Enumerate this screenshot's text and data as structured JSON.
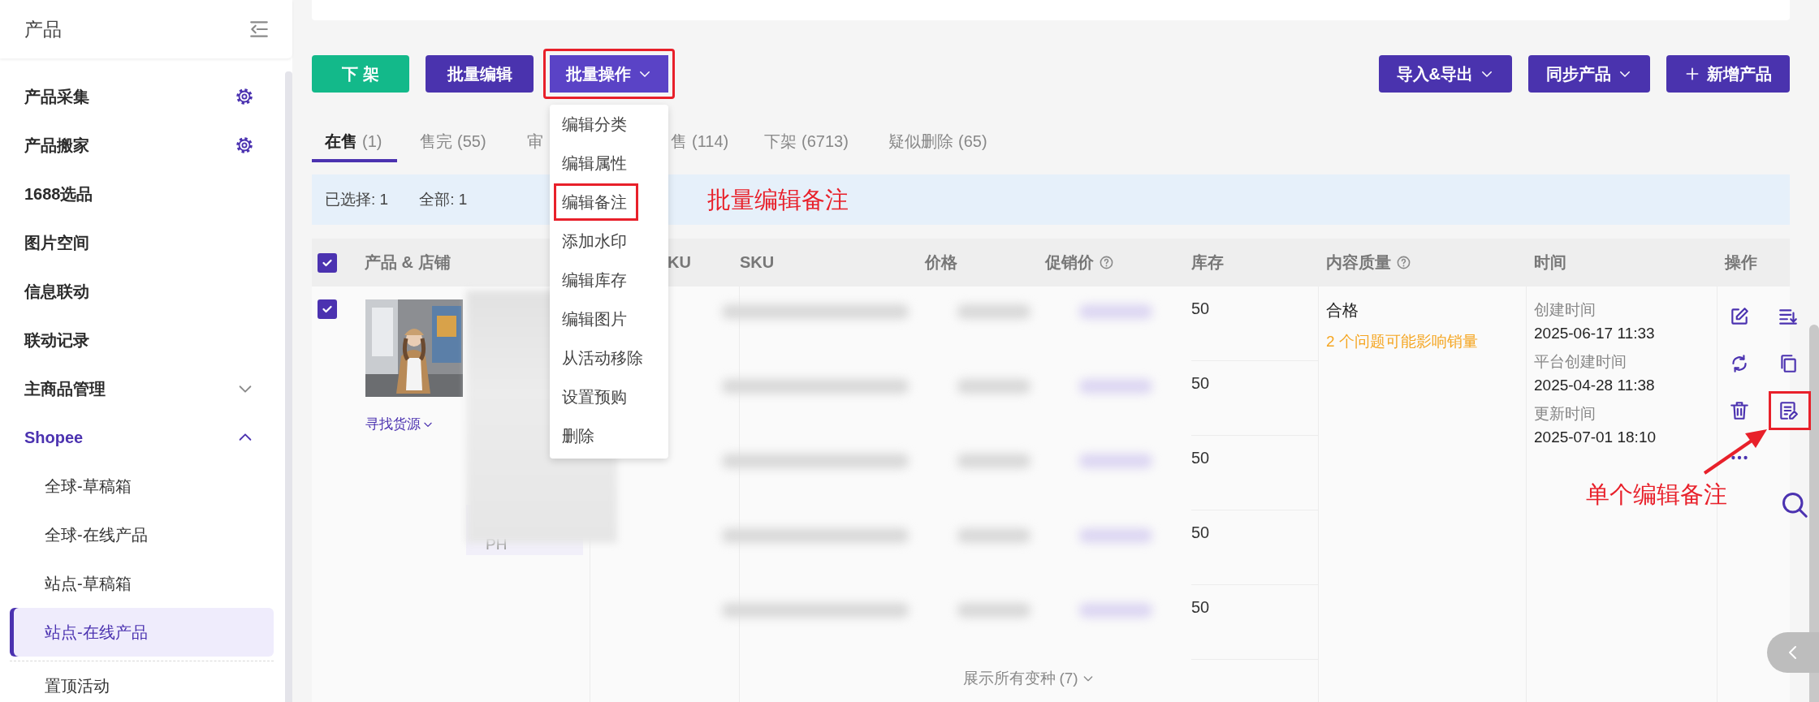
{
  "sidebar": {
    "title": "产品",
    "items": [
      {
        "label": "产品采集",
        "kind": "setting"
      },
      {
        "label": "产品搬家",
        "kind": "setting"
      },
      {
        "label": "1688选品",
        "kind": "plain"
      },
      {
        "label": "图片空间",
        "kind": "plain"
      },
      {
        "label": "信息联动",
        "kind": "plain"
      },
      {
        "label": "联动记录",
        "kind": "plain"
      },
      {
        "label": "主商品管理",
        "kind": "group",
        "expanded": false
      },
      {
        "label": "Shopee",
        "kind": "group",
        "expanded": true,
        "children": [
          {
            "label": "全球-草稿箱",
            "selected": false,
            "divider_before": false
          },
          {
            "label": "全球-在线产品",
            "selected": false,
            "divider_before": false
          },
          {
            "label": "站点-草稿箱",
            "selected": false,
            "divider_before": false
          },
          {
            "label": "站点-在线产品",
            "selected": true,
            "divider_before": false
          },
          {
            "label": "置顶活动",
            "selected": false,
            "divider_before": true
          }
        ]
      }
    ]
  },
  "toolbar": {
    "left_buttons": [
      {
        "label": "下 架",
        "kind": "success",
        "caret": false,
        "annotated": false
      },
      {
        "label": "批量编辑",
        "kind": "primary",
        "caret": false,
        "annotated": false
      },
      {
        "label": "批量操作",
        "kind": "accent",
        "caret": true,
        "annotated": true
      }
    ],
    "right_buttons": [
      {
        "label": "导入&导出",
        "kind": "primary",
        "caret": true
      },
      {
        "label": "同步产品",
        "kind": "primary",
        "caret": true
      },
      {
        "label": "新增产品",
        "kind": "add",
        "caret": false
      }
    ]
  },
  "dropdown_menu": [
    {
      "label": "编辑分类",
      "annotated": false
    },
    {
      "label": "编辑属性",
      "annotated": false
    },
    {
      "label": "编辑备注",
      "annotated": true
    },
    {
      "label": "添加水印",
      "annotated": false
    },
    {
      "label": "编辑库存",
      "annotated": false
    },
    {
      "label": "编辑图片",
      "annotated": false
    },
    {
      "label": "从活动移除",
      "annotated": false
    },
    {
      "label": "设置预购",
      "annotated": false
    },
    {
      "label": "删除",
      "annotated": false
    }
  ],
  "tabs": [
    {
      "label": "在售",
      "count": "(1)",
      "selected": true
    },
    {
      "label": "售完",
      "count": "(55)",
      "selected": false
    },
    {
      "label": "审",
      "selected": false
    },
    {
      "label": "售",
      "count": "(114)",
      "selected": false
    },
    {
      "label": "下架",
      "count": "(6713)",
      "selected": false
    },
    {
      "label": "疑似删除",
      "count": "(65)",
      "selected": false
    }
  ],
  "selection_bar": {
    "selected": "已选择: 1",
    "total": "全部: 1"
  },
  "table": {
    "all_checked": true,
    "columns": [
      {
        "label": "产品 & 店铺",
        "help": false
      },
      {
        "label": "KU",
        "help": false
      },
      {
        "label": "SKU",
        "help": false
      },
      {
        "label": "价格",
        "help": false
      },
      {
        "label": "促销价",
        "help": true
      },
      {
        "label": "库存",
        "help": false
      },
      {
        "label": "内容质量",
        "help": true
      },
      {
        "label": "时间",
        "help": false
      },
      {
        "label": "操作",
        "help": false
      }
    ],
    "rows": [
      {
        "checked": true,
        "find_source": "寻找货源",
        "store_region": "PH",
        "stock": [
          "50",
          "50",
          "50",
          "50",
          "50"
        ],
        "show_variants": "展示所有变种",
        "variant_count": "(7)",
        "quality": "合格",
        "quality_issue": "2 个问题可能影响销量",
        "times": [
          {
            "label": "创建时间",
            "value": "2025-06-17 11:33"
          },
          {
            "label": "平台创建时间",
            "value": "2025-04-28 11:38"
          },
          {
            "label": "更新时间",
            "value": "2025-07-01 18:10"
          }
        ],
        "actions": [
          {
            "kind": "edit",
            "annotated": false
          },
          {
            "kind": "sort",
            "annotated": false
          },
          {
            "kind": "sync",
            "annotated": false
          },
          {
            "kind": "copy",
            "annotated": false
          },
          {
            "kind": "delete",
            "annotated": false
          },
          {
            "kind": "note",
            "annotated": true
          },
          {
            "kind": "more",
            "annotated": false
          }
        ]
      }
    ]
  },
  "annotations": [
    {
      "text": "批量编辑备注"
    },
    {
      "text": "单个编辑备注",
      "arrow": true
    }
  ]
}
